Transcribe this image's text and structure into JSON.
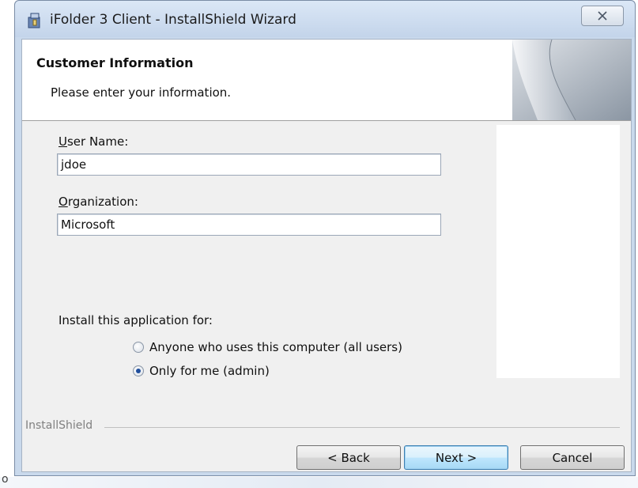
{
  "window": {
    "title": "iFolder 3 Client - InstallShield Wizard",
    "close_glyph": "╳"
  },
  "banner": {
    "title": "Customer Information",
    "subtitle": "Please enter your information."
  },
  "form": {
    "username_label_accel": "U",
    "username_label_rest": "ser Name:",
    "username_value": "jdoe",
    "org_label_accel": "O",
    "org_label_rest": "rganization:",
    "org_value": "Microsoft",
    "install_for_label": "Install this application for:",
    "options": [
      {
        "label": "Anyone who uses this computer (all users)",
        "checked": false
      },
      {
        "label": "Only for me (admin)",
        "checked": true
      }
    ]
  },
  "footer": {
    "brand": "InstallShield",
    "back_label": "< Back",
    "next_label": "Next >",
    "cancel_label": "Cancel"
  },
  "stray_text": "o",
  "colors": {
    "radio_selected": "#1f4e9c",
    "default_button_border": "#3c7fb1",
    "titlebar": "#c9d9ec"
  },
  "icons": {
    "app": "installer-package-icon",
    "close": "close-icon",
    "banner": "page-curl-graphic"
  }
}
